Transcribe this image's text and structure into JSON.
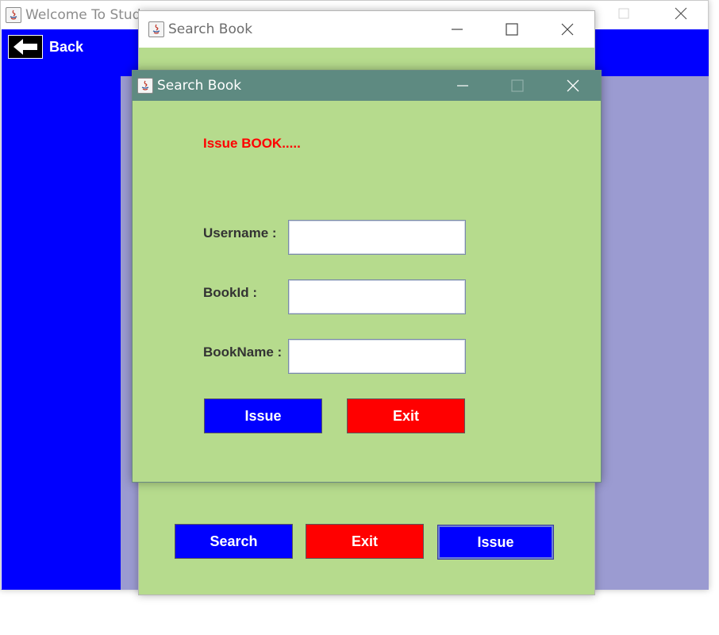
{
  "main_window": {
    "title": "Welcome To Stud",
    "back_label": "Back",
    "colors": {
      "band": "#0000ff",
      "right_panel": "#9b9bd1"
    }
  },
  "search_window": {
    "title": "Search Book",
    "buttons": {
      "search": "Search",
      "exit": "Exit",
      "issue": "Issue"
    }
  },
  "issue_window": {
    "title": "Search Book",
    "heading": "Issue BOOK.....",
    "fields": {
      "username_label": "Username :",
      "username_value": "",
      "bookid_label": "BookId :",
      "bookid_value": "",
      "bookname_label": "BookName :",
      "bookname_value": ""
    },
    "buttons": {
      "issue": "Issue",
      "exit": "Exit"
    }
  },
  "icons": {
    "app": "java-icon",
    "minimize": "minimize-icon",
    "maximize": "maximize-icon",
    "close": "close-icon",
    "back": "arrow-left-icon"
  },
  "colors": {
    "panel_green": "#b6db8d",
    "dialog_titlebar": "#5e8a81",
    "button_blue": "#0000ff",
    "button_red": "#ff0000",
    "heading_red": "#ff0000"
  }
}
